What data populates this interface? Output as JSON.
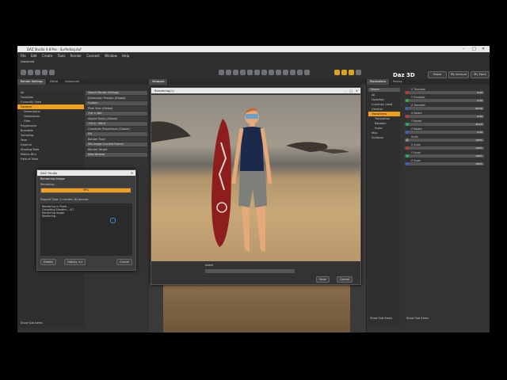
{
  "window": {
    "title": "DAZ Studio 4.8 Pro - Surferboy.duf"
  },
  "menu": [
    "File",
    "Edit",
    "Create",
    "Tools",
    "Render",
    "Connect",
    "Window",
    "Help"
  ],
  "scene_label": "Advanced",
  "top_tabs": {
    "home": "Home",
    "account": "My Account",
    "store": "My Store"
  },
  "brand": "Daz 3D",
  "left_panel": {
    "tabs": [
      "Render Settings",
      "Editor",
      "Advanced"
    ],
    "items": [
      "All",
      "Favorites",
      "Currently Used",
      "General",
      "Dimensions",
      "Destination",
      "Filter",
      "Progressive",
      "Burnable",
      "Sampling",
      "Tone",
      "Gamma",
      "Shading Rate",
      "Motion Blur",
      "Field of View"
    ],
    "show_sub": "Show Sub Items"
  },
  "render_settings": {
    "search": "Search Render Settings",
    "fields": [
      "Dimension Presets (Global)",
      "Pixel Size (Global)",
      "Aspect Ratio (Global)",
      "Constrain Proportions (Global)",
      "Render Type",
      "Still Image (Current Frame)",
      "Render Target",
      "New Window"
    ],
    "w": "720",
    "h": "480",
    "a1": "720.0",
    "a2": "480.0",
    "pct": "0%"
  },
  "progress_dialog": {
    "title": "DAZ Studio",
    "heading": "Rendering Image",
    "sub": "Rendering...",
    "percent": "99%",
    "progress": 0.99,
    "elapsed": "Elapsed Time: 2 minutes 48 seconds",
    "log": [
      "Rendering in Pixels...",
      "Compiling Shaders... 0/7",
      "Rendering Image",
      "Rendering..."
    ],
    "buttons": {
      "details": "Details",
      "hide": "History <<",
      "cancel": "Cancel"
    }
  },
  "render_window": {
    "title": "Rendering(1)",
    "name_label": "Name",
    "save": "Save",
    "cancel": "Cancel"
  },
  "params": {
    "tabs": [
      "Parameters",
      "Posing"
    ],
    "search": "Search",
    "items": [
      "All",
      "Favorites",
      "Currently Used",
      "General",
      "Transforms",
      "Translation",
      "Rotation",
      "Scale",
      "Misc",
      "Surfaces"
    ],
    "sliders": [
      {
        "label": "X Translate",
        "value": "0.00",
        "color": "#c0392b"
      },
      {
        "label": "Y Translate",
        "value": "0.00",
        "color": "#27ae60"
      },
      {
        "label": "Z Translate",
        "value": "-56.00",
        "color": "#2e63c7"
      },
      {
        "label": "X Rotate",
        "value": "0.00",
        "color": "#c0392b"
      },
      {
        "label": "Y Rotate",
        "value": "-32.00",
        "color": "#27ae60"
      },
      {
        "label": "Z Rotate",
        "value": "0.00",
        "color": "#2e63c7"
      },
      {
        "label": "Scale",
        "value": "100%",
        "color": "#888"
      },
      {
        "label": "X Scale",
        "value": "100%",
        "color": "#c0392b"
      },
      {
        "label": "Y Scale",
        "value": "100%",
        "color": "#27ae60"
      },
      {
        "label": "Z Scale",
        "value": "100%",
        "color": "#2e63c7"
      }
    ],
    "show_sub": "Show Sub Items"
  }
}
